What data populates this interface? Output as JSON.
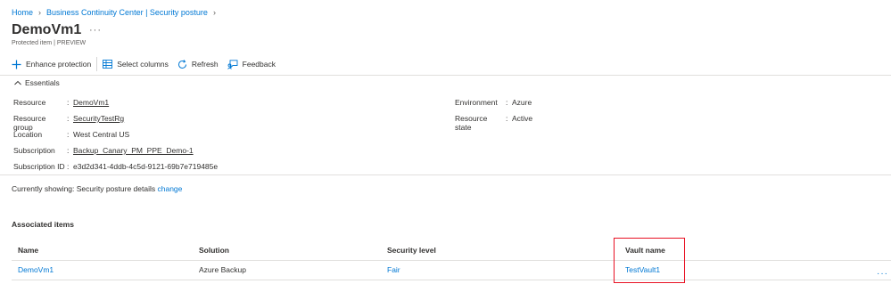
{
  "breadcrumb": {
    "home": "Home",
    "bcc": "Business Continuity Center | Security posture"
  },
  "page": {
    "title": "DemoVm1",
    "more": "···",
    "subtitle": "Protected item | PREVIEW"
  },
  "toolbar": {
    "enhance": "Enhance protection",
    "select_columns": "Select columns",
    "refresh": "Refresh",
    "feedback": "Feedback"
  },
  "essentials": {
    "label": "Essentials",
    "left": [
      {
        "key": "Resource",
        "value": "DemoVm1",
        "link": true
      },
      {
        "key": "Resource group",
        "value": "SecurityTestRg",
        "link": true
      },
      {
        "key": "Location",
        "value": "West Central US",
        "link": false
      },
      {
        "key": "Subscription",
        "value": "Backup_Canary_PM_PPE_Demo-1",
        "link": true
      },
      {
        "key": "Subscription ID",
        "value": "e3d2d341-4ddb-4c5d-9121-69b7e719485e",
        "link": false
      }
    ],
    "right": [
      {
        "key": "Environment",
        "value": "Azure"
      },
      {
        "key": "Resource state",
        "value": "Active"
      }
    ]
  },
  "showing": {
    "prefix": "Currently showing: Security posture details",
    "change": "change"
  },
  "associated": {
    "title": "Associated items",
    "columns": [
      "Name",
      "Solution",
      "Security level",
      "Vault name"
    ],
    "rows": [
      {
        "name": "DemoVm1",
        "solution": "Azure Backup",
        "security": "Fair",
        "vault": "TestVault1",
        "more": "···"
      }
    ]
  },
  "colors": {
    "accent": "#0078d4",
    "highlight": "#e81123"
  }
}
